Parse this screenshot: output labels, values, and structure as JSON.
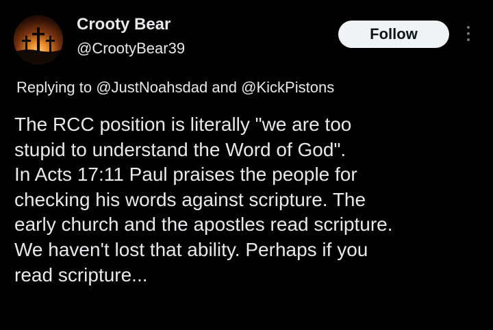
{
  "author": {
    "display_name": "Crooty Bear",
    "handle": "@CrootyBear39",
    "avatar_icon": "crosses-sunset-icon"
  },
  "actions": {
    "follow_label": "Follow",
    "more_icon": "more-vertical-icon"
  },
  "reply": {
    "prefix": "Replying to",
    "mention_1": "@JustNoahsdad",
    "joiner": "and",
    "mention_2": "@KickPistons"
  },
  "tweet": {
    "lines": [
      "The RCC position is literally \"we are too",
      "stupid to understand the Word of God\".",
      "In Acts 17:11 Paul praises the people for",
      "checking his words against scripture. The",
      "early church and the apostles read scripture.",
      "We haven't lost that ability. Perhaps if you",
      "read scripture..."
    ]
  },
  "colors": {
    "background": "#000000",
    "text": "#e7e9ea",
    "button_bg": "#eff3f4",
    "button_text": "#0f1419",
    "muted": "#71767b"
  }
}
